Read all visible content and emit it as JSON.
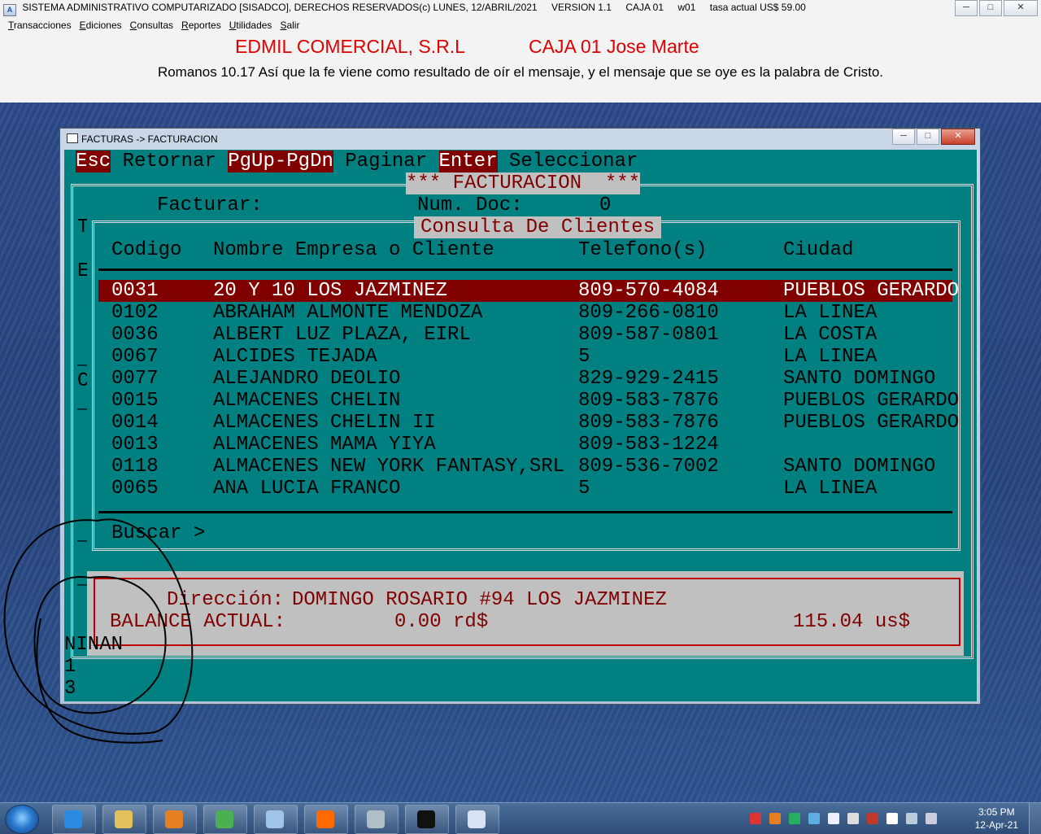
{
  "app": {
    "title_segments": [
      "SISTEMA ADMINISTRATIVO COMPUTARIZADO [SISADCO], DERECHOS RESERVADOS(c)  LUNES, 12/ABRIL/2021",
      "VERSION 1.1",
      "CAJA 01",
      "w01",
      "tasa actual US$ 59.00"
    ],
    "menu": [
      "Transacciones",
      "Ediciones",
      "Consultas",
      "Reportes",
      "Utilidades",
      "Salir"
    ],
    "company": "EDMIL COMERCIAL, S.R.L",
    "caja_user": "CAJA 01  Jose Marte",
    "verse": "Romanos 10.17 Así que la fe viene como resultado de oír el mensaje, y el mensaje que se oye es la palabra de Cristo."
  },
  "window": {
    "title": "FACTURAS -> FACTURACION",
    "controls": [
      "─",
      "□",
      "✕"
    ]
  },
  "console": {
    "keys": [
      {
        "key": "Esc",
        "label": " Retornar "
      },
      {
        "key": "PgUp-PgDn",
        "label": " Paginar "
      },
      {
        "key": "Enter",
        "label": " Seleccionar"
      }
    ],
    "section_title": "*** FACTURACION  ***",
    "facturar_label": "Facturar:",
    "num_doc_label": "Num. Doc:",
    "num_doc_value": "0",
    "left_letters": [
      "T",
      "E",
      "_",
      "C",
      "_",
      "_",
      "_",
      "C"
    ],
    "dialog_title": "Consulta De Clientes",
    "columns": [
      "Codigo",
      "Nombre Empresa o Cliente",
      "Telefono(s)",
      "Ciudad"
    ],
    "rows": [
      {
        "code": "0031",
        "name": "20 Y 10 LOS JAZMINEZ",
        "phone": "809-570-4084",
        "city": "PUEBLOS GERARDO"
      },
      {
        "code": "0102",
        "name": "ABRAHAM ALMONTE MENDOZA",
        "phone": "809-266-0810",
        "city": "LA LINEA"
      },
      {
        "code": "0036",
        "name": "ALBERT LUZ PLAZA, EIRL",
        "phone": "809-587-0801",
        "city": "LA COSTA"
      },
      {
        "code": "0067",
        "name": "ALCIDES TEJADA",
        "phone": "5",
        "city": "LA LINEA"
      },
      {
        "code": "0077",
        "name": "ALEJANDRO DEOLIO",
        "phone": "829-929-2415",
        "city": "SANTO DOMINGO"
      },
      {
        "code": "0015",
        "name": "ALMACENES CHELIN",
        "phone": "809-583-7876",
        "city": "PUEBLOS GERARDO"
      },
      {
        "code": "0014",
        "name": "ALMACENES CHELIN II",
        "phone": "809-583-7876",
        "city": "PUEBLOS GERARDO"
      },
      {
        "code": "0013",
        "name": "ALMACENES MAMA YIYA",
        "phone": "809-583-1224",
        "city": ""
      },
      {
        "code": "0118",
        "name": "ALMACENES NEW YORK FANTASY,SRL",
        "phone": "809-536-7002",
        "city": "SANTO DOMINGO"
      },
      {
        "code": "0065",
        "name": "ANA LUCIA FRANCO",
        "phone": "5",
        "city": "LA LINEA"
      }
    ],
    "selected_row": 0,
    "search_label": "Buscar >",
    "address_label": "Dirección:",
    "address_value": "DOMINGO ROSARIO #94 LOS JAZMINEZ",
    "balance_label": "BALANCE ACTUAL:",
    "balance_rd": "0.00 rd$",
    "balance_us": "115.04 us$",
    "bottom_lines": [
      "NINAN",
      "1",
      "3"
    ]
  },
  "taskbar": {
    "time": "3:05 PM",
    "date": "12-Apr-21",
    "items": [
      "internet-explorer",
      "file-explorer",
      "media-player",
      "chrome",
      "paint",
      "firefox",
      "calculator",
      "command-prompt",
      "sisadco"
    ]
  },
  "colors": {
    "console_bg": "#008080",
    "highlight": "#800000",
    "gray_panel": "#c0c0c0",
    "header_red": "#e00000"
  }
}
